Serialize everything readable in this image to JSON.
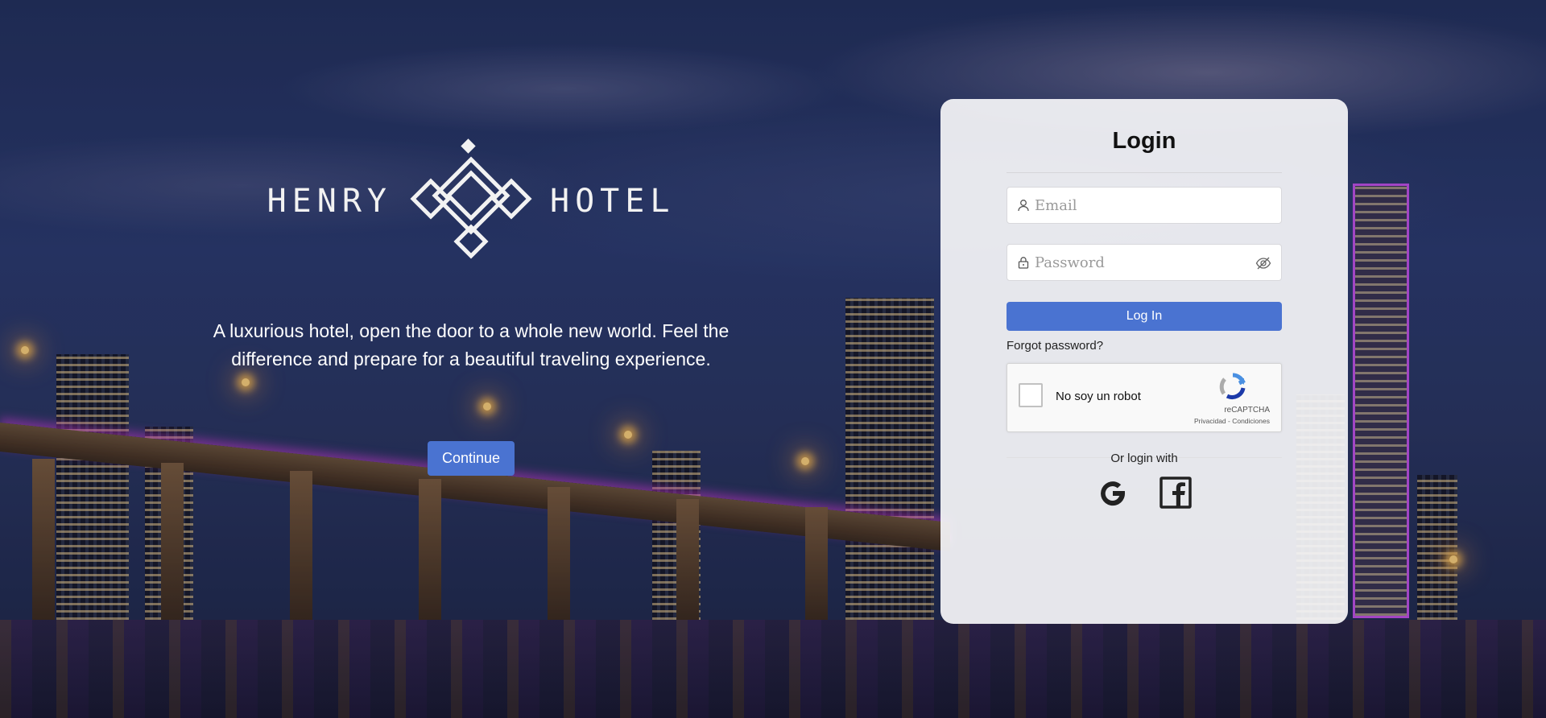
{
  "brand": {
    "name_left": "HENRY",
    "name_right": "HOTEL"
  },
  "hero": {
    "tagline": "A luxurious hotel, open the door to a whole new world. Feel the difference and prepare for a beautiful traveling experience.",
    "continue_label": "Continue"
  },
  "login": {
    "title": "Login",
    "email_placeholder": "Email",
    "password_placeholder": "Password",
    "submit_label": "Log In",
    "forgot_label": "Forgot password?",
    "captcha": {
      "label": "No soy un robot",
      "brand": "reCAPTCHA",
      "links": "Privacidad - Condiciones"
    },
    "or_label": "Or login with",
    "social": [
      {
        "icon": "google-icon"
      },
      {
        "icon": "facebook-icon"
      }
    ]
  },
  "colors": {
    "accent": "#4a73d1",
    "card_bg": "#f5f5f8"
  }
}
